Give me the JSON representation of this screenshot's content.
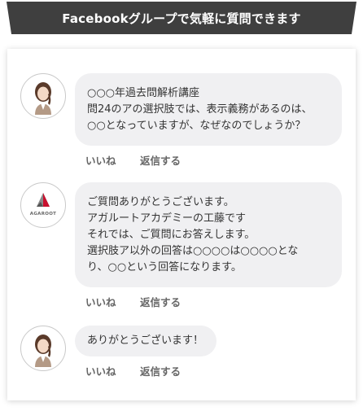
{
  "banner": {
    "title": "Facebookグループで気軽に質問できます"
  },
  "comments": [
    {
      "lines": [
        "○○○年過去問解析講座",
        "問24のアの選択肢では、表示義務があるのは、",
        "○○となっていますが、なぜなのでしょうか？"
      ],
      "actions": {
        "like": "いいね",
        "reply": "返信する"
      }
    },
    {
      "logo_text": "AGAROOT",
      "lines": [
        "ご質問ありがとうございます。",
        "アガルートアカデミーの工藤です",
        "それでは、ご質問にお答えします。",
        "選択肢ア以外の回答は○○○○は○○○○とな",
        "り、○○という回答になります。"
      ],
      "actions": {
        "like": "いいね",
        "reply": "返信する"
      }
    },
    {
      "lines": [
        "ありがとうございます！"
      ],
      "actions": {
        "like": "いいね",
        "reply": "返信する"
      }
    }
  ],
  "colors": {
    "banner_bg": "#3f3f3f",
    "bubble_bg": "#f0f0f2",
    "action_text": "#666666",
    "logo_red": "#c8102e"
  }
}
